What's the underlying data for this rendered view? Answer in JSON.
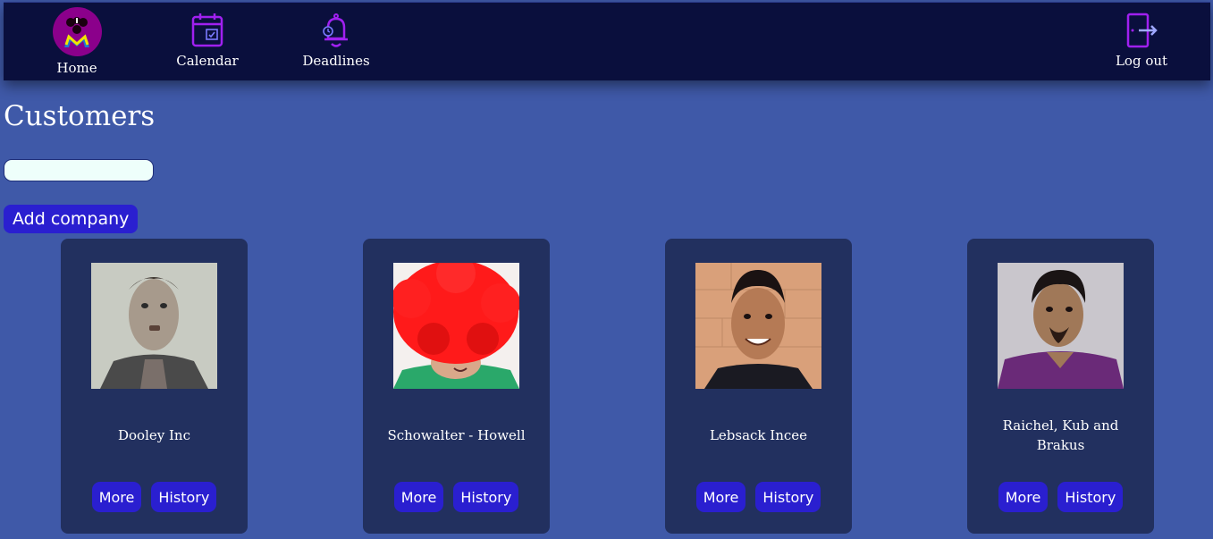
{
  "nav": {
    "home_label": "Home",
    "calendar_label": "Calendar",
    "deadlines_label": "Deadlines",
    "logout_label": "Log out"
  },
  "page": {
    "title": "Customers",
    "search_placeholder": "",
    "add_button": "Add company"
  },
  "customers": [
    {
      "name": "Dooley Inc",
      "more_label": "More",
      "history_label": "History"
    },
    {
      "name": "Schowalter - Howell",
      "more_label": "More",
      "history_label": "History"
    },
    {
      "name": "Lebsack Incee",
      "more_label": "More",
      "history_label": "History"
    },
    {
      "name": "Raichel, Kub and Brakus",
      "more_label": "More",
      "history_label": "History"
    }
  ],
  "colors": {
    "background": "#3f59a8",
    "navbar": "#0a0f3d",
    "card": "#22305f",
    "button": "#2a1fd0",
    "icon_accent": "#a020f0"
  }
}
